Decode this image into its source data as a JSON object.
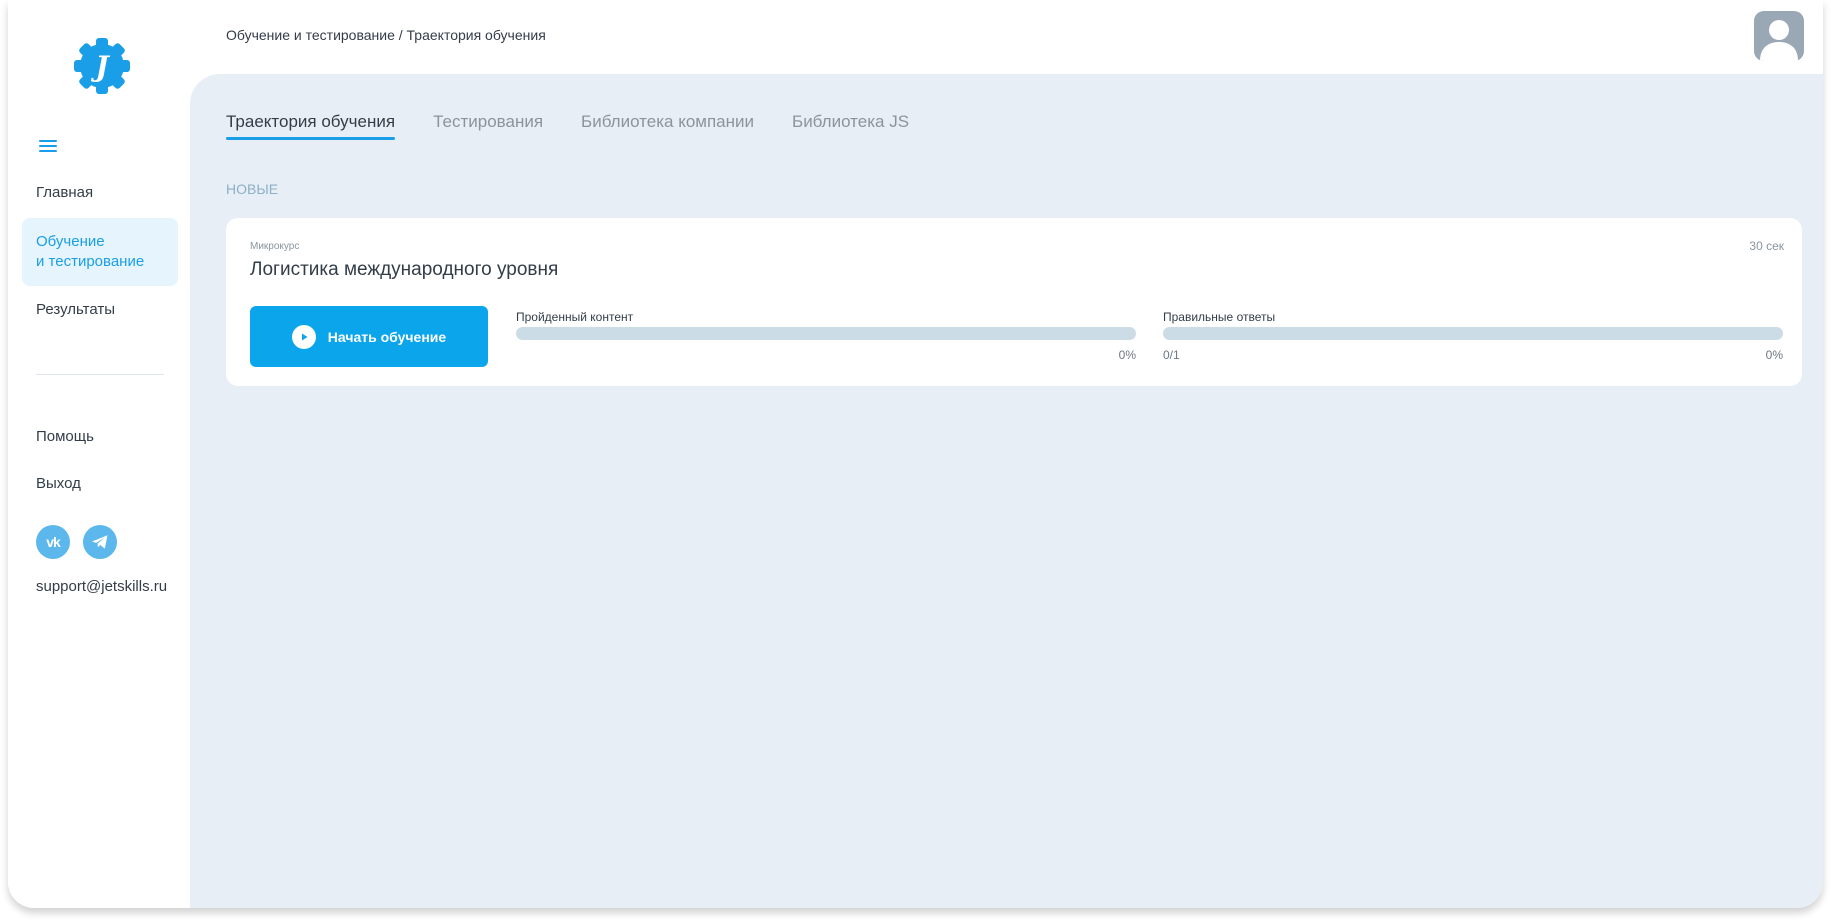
{
  "header": {
    "breadcrumb": "Обучение и тестирование / Траектория обучения"
  },
  "sidebar": {
    "logo_letter": "J",
    "items": [
      {
        "label": "Главная"
      },
      {
        "label": "Обучение\nи тестирование"
      },
      {
        "label": "Результаты"
      },
      {
        "label": "Помощь"
      },
      {
        "label": "Выход"
      }
    ],
    "vk_label": "vk",
    "support_email": "support@jetskills.ru"
  },
  "tabs": [
    {
      "label": "Траектория обучения"
    },
    {
      "label": "Тестирования"
    },
    {
      "label": "Библиотека компании"
    },
    {
      "label": "Библиотека JS"
    }
  ],
  "section_label": "НОВЫЕ",
  "course": {
    "type": "Микрокурс",
    "duration": "30 сек",
    "title": "Логистика международного уровня",
    "start_button": "Начать обучение",
    "content_progress": {
      "label": "Пройденный контент",
      "percent_text": "0%",
      "fraction": 0
    },
    "answers_progress": {
      "label": "Правильные ответы",
      "count_text": "0/1",
      "percent_text": "0%",
      "fraction": 0
    }
  },
  "colors": {
    "accent": "#1a9ee8",
    "button": "#0aa5ea",
    "main_bg": "#e8eef5",
    "progress_track": "#ccdce6"
  },
  "icons": [
    "jetskills-gear-logo",
    "menu-icon",
    "vk-icon",
    "telegram-icon",
    "avatar-icon",
    "play-icon"
  ]
}
